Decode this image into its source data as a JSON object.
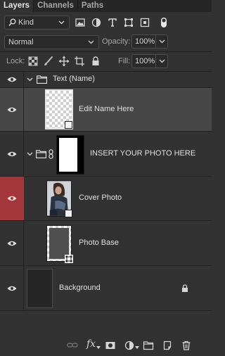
{
  "tabs": [
    {
      "label": "Layers",
      "active": true
    },
    {
      "label": "Channels",
      "active": false
    },
    {
      "label": "Paths",
      "active": false
    }
  ],
  "filter": {
    "kind_label": "Kind",
    "icons": [
      "pixel-filter-icon",
      "adjustment-filter-icon",
      "type-filter-icon",
      "shape-filter-icon",
      "smart-object-filter-icon",
      "filter-toggle-icon"
    ]
  },
  "blend": {
    "mode": "Normal",
    "opacity_label": "Opacity:",
    "opacity_value": "100%"
  },
  "lock": {
    "label": "Lock:",
    "icons": [
      "lock-transparent-pixels-icon",
      "lock-image-pixels-icon",
      "lock-position-icon",
      "lock-artboard-icon",
      "lock-all-icon"
    ],
    "fill_label": "Fill:",
    "fill_value": "100%"
  },
  "layers": [
    {
      "name": "Text (Name)",
      "type": "group"
    },
    {
      "name": "Edit Name Here",
      "type": "smart-object"
    },
    {
      "name": "INSERT YOUR PHOTO HERE",
      "type": "masked-group"
    },
    {
      "name": "Cover Photo",
      "type": "smart-object-photo"
    },
    {
      "name": "Photo Base",
      "type": "shape"
    },
    {
      "name": "Background",
      "type": "background",
      "locked": true
    }
  ],
  "bottom_icons": [
    "link-layers-icon",
    "fx-icon",
    "add-mask-icon",
    "adjustment-layer-icon",
    "new-group-icon",
    "new-layer-icon",
    "trash-icon"
  ],
  "bottom_fx_label": "fx",
  "colors": {
    "panel": "#323232",
    "selected_row": "#474747",
    "eye_highlight": "#a3363a"
  }
}
